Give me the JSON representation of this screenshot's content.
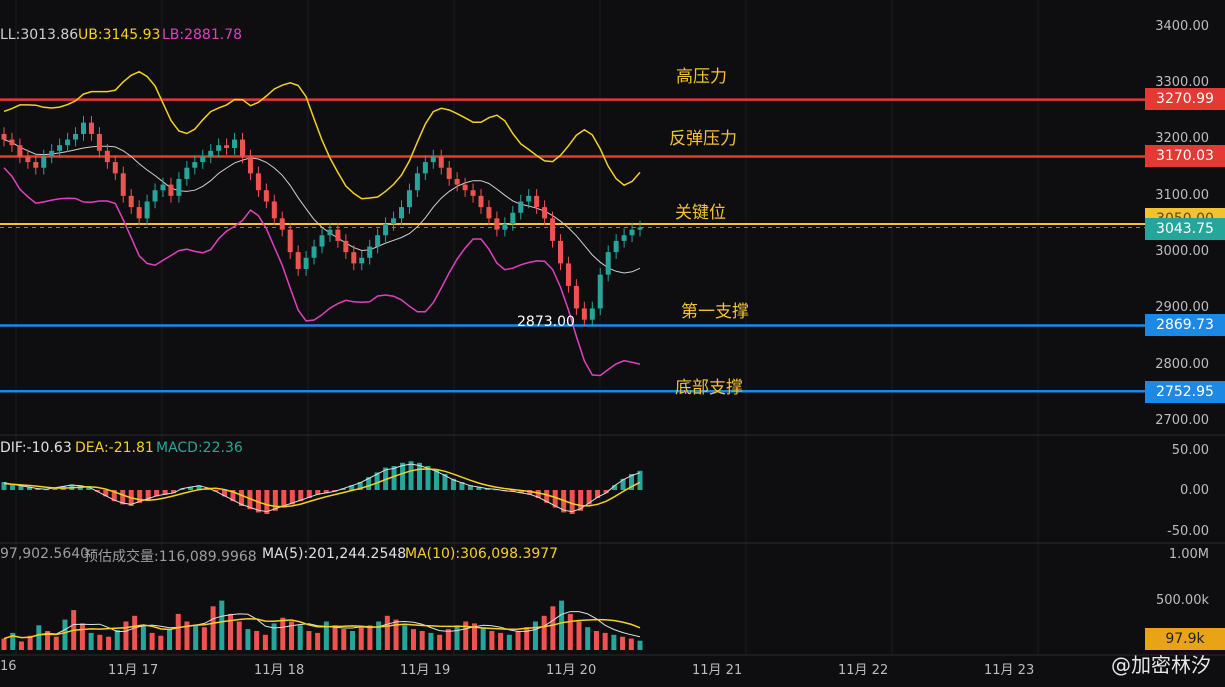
{
  "header": {
    "boll_mid": "LL:3013.86",
    "boll_ub": "UB:3145.93",
    "boll_lb": "LB:2881.78",
    "macd_dif": "DIF:-10.63",
    "macd_dea": "DEA:-21.81",
    "macd_val": "MACD:22.36",
    "vol_cur": "97,902.5640",
    "vol_est": "预估成交量:116,089.9968",
    "vol_ma5": "MA(5):201,244.2548",
    "vol_ma10": "MA(10):306,098.3977"
  },
  "annotations": {
    "high_pressure": "高压力",
    "rebound_pressure": "反弹压力",
    "key_level": "关键位",
    "first_support": "第一支撑",
    "bottom_support": "底部支撑",
    "low_marker": "2873.00"
  },
  "price_tags": {
    "t1": "3270.99",
    "t2": "3170.03",
    "t3": "3050.00",
    "t4": "3043.75",
    "t5": "2869.73",
    "t6": "2752.95",
    "t7": "97.9k"
  },
  "y_axis": [
    "3400.00",
    "3300.00",
    "3200.00",
    "3100.00",
    "3000.00",
    "2900.00",
    "2800.00",
    "2700.00"
  ],
  "macd_axis": [
    "50.00",
    "0.00",
    "-50.00"
  ],
  "vol_axis": [
    "1.00M",
    "500.00k"
  ],
  "x_axis": [
    "16",
    "11月 17",
    "11月 18",
    "11月 19",
    "11月 20",
    "11月 21",
    "11月 22",
    "11月 23"
  ],
  "watermark": "@加密林汐",
  "colors": {
    "up": "#26a69a",
    "down": "#ef5350",
    "boll_ub": "#f5d020",
    "boll_lb": "#e040c0",
    "boll_mid": "#cfcfcf",
    "red_line": "#e53935",
    "blue_line": "#1e88e5",
    "key_line": "#f2c230"
  },
  "chart_data": {
    "type": "candlestick",
    "ylim": [
      2700,
      3400
    ],
    "levels": [
      3270.99,
      3170.03,
      3050.0,
      2869.73,
      2752.95
    ],
    "current_price": 3043.75,
    "period_low": 2873.0,
    "closes": [
      3200,
      3190,
      3170,
      3160,
      3150,
      3170,
      3180,
      3190,
      3200,
      3210,
      3230,
      3210,
      3180,
      3160,
      3140,
      3100,
      3080,
      3060,
      3090,
      3110,
      3120,
      3100,
      3130,
      3150,
      3160,
      3170,
      3180,
      3190,
      3185,
      3200,
      3170,
      3140,
      3110,
      3090,
      3060,
      3040,
      3000,
      2970,
      2990,
      3010,
      3030,
      3040,
      3020,
      3000,
      2980,
      2990,
      3010,
      3030,
      3050,
      3060,
      3080,
      3110,
      3140,
      3160,
      3170,
      3150,
      3130,
      3120,
      3110,
      3100,
      3080,
      3060,
      3040,
      3050,
      3070,
      3090,
      3100,
      3080,
      3060,
      3020,
      2980,
      2940,
      2900,
      2880,
      2900,
      2960,
      3000,
      3020,
      3030,
      3040,
      3043.75
    ],
    "macd_hist": [
      10,
      8,
      6,
      4,
      2,
      1,
      3,
      5,
      7,
      6,
      4,
      -2,
      -8,
      -14,
      -18,
      -20,
      -16,
      -12,
      -8,
      -6,
      -4,
      2,
      4,
      6,
      3,
      -2,
      -8,
      -14,
      -20,
      -24,
      -28,
      -30,
      -26,
      -22,
      -18,
      -14,
      -10,
      -6,
      -4,
      -2,
      2,
      6,
      10,
      16,
      22,
      28,
      30,
      34,
      36,
      34,
      30,
      26,
      20,
      14,
      10,
      6,
      4,
      2,
      1,
      -1,
      -2,
      -4,
      -6,
      -10,
      -16,
      -22,
      -28,
      -30,
      -26,
      -18,
      -10,
      -4,
      6,
      14,
      20,
      24
    ],
    "volume": [
      120,
      180,
      90,
      150,
      260,
      200,
      140,
      320,
      420,
      280,
      180,
      160,
      140,
      210,
      300,
      360,
      260,
      180,
      150,
      220,
      380,
      300,
      260,
      240,
      460,
      520,
      380,
      300,
      220,
      200,
      160,
      280,
      340,
      300,
      260,
      200,
      180,
      300,
      260,
      220,
      200,
      240,
      260,
      300,
      360,
      320,
      260,
      220,
      200,
      180,
      160,
      220,
      260,
      300,
      280,
      240,
      200,
      180,
      160,
      200,
      240,
      300,
      360,
      460,
      520,
      380,
      300,
      240,
      200,
      180,
      160,
      140,
      120,
      98
    ]
  }
}
